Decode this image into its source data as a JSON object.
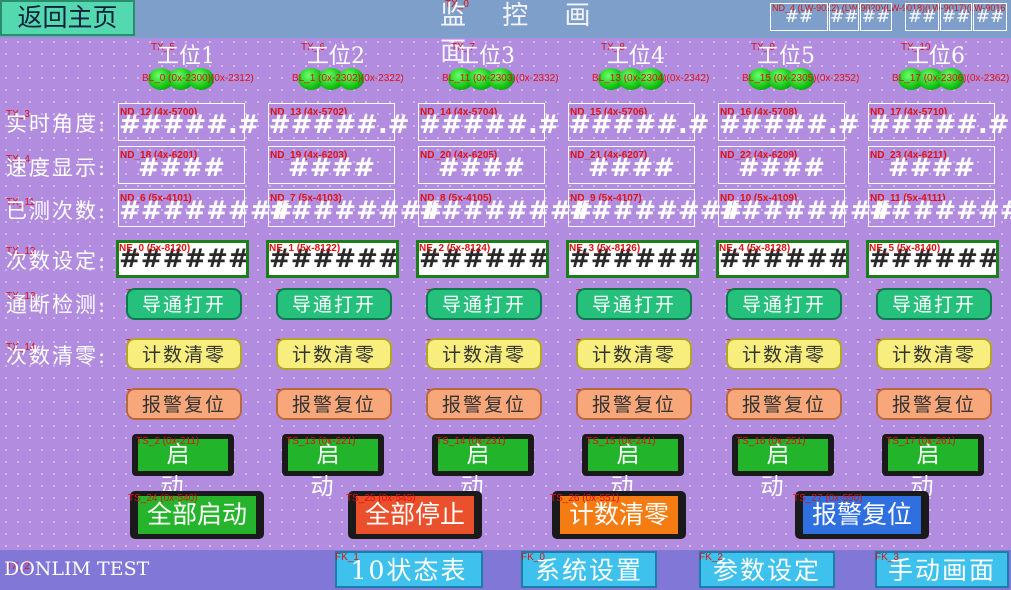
{
  "header": {
    "home_label": "返回主页",
    "title": "监 控 画 面",
    "title_tag": "TX_0",
    "top_tags": "ND_4 (LW-9022) (LW-9020)(LW-9018)(LW-9017)(LW-9016)",
    "top_nums": [
      "##",
      "##",
      "##",
      "##",
      "##",
      "##"
    ]
  },
  "stations": [
    {
      "head": "工位1",
      "tag": "TX_5",
      "bl": "BL_0 (0x-2300)(0x-2312)",
      "angle_tag": "ND_12 (4x-5700)",
      "speed_tag": "ND_18 (4x-6201)",
      "count_tag": "ND_6 (5x-4101)",
      "set_tag": "NE_0 (5x-8120)",
      "chk_tag": "TS_23 (0x-762)",
      "clr_tag": "TS_0 (0x-2101)",
      "rst_tag": "TS_1 (0x-2111)",
      "start_tag": "TS_2 (0x-211)"
    },
    {
      "head": "工位2",
      "tag": "TX_6",
      "bl": "BL_1 (0x-2302)(0x-2322)",
      "angle_tag": "ND_13 (4x-5702)",
      "speed_tag": "ND_19 (4x-6203)",
      "count_tag": "ND_7 (5x-4103)",
      "set_tag": "NE_1 (5x-8122)",
      "chk_tag": "TS_18 (0x-763)",
      "clr_tag": "TS_3 (0x-2102)",
      "rst_tag": "TS_9 (0x-2112)",
      "start_tag": "TS_13 (0x-221)"
    },
    {
      "head": "工位3",
      "tag": "TX_7",
      "bl": "BL_11 (0x-2303)(0x-2332)",
      "angle_tag": "ND_14 (4x-5704)",
      "speed_tag": "ND_20 (4x-6205)",
      "count_tag": "ND_8 (5x-4105)",
      "set_tag": "NE_2 (5x-8124)",
      "chk_tag": "TS_19 (0x-764)",
      "clr_tag": "TS_4 (0x-2103)",
      "rst_tag": "TS_8 (0x-2113)",
      "start_tag": "TS_14 (0x-231)"
    },
    {
      "head": "工位4",
      "tag": "TX_8",
      "bl": "BL_13 (0x-2304)(0x-2342)",
      "angle_tag": "ND_15 (4x-5706)",
      "speed_tag": "ND_21 (4x-6207)",
      "count_tag": "ND_9 (5x-4107)",
      "set_tag": "NE_3 (5x-8126)",
      "chk_tag": "TS_20 (0x-765)",
      "clr_tag": "TS_5 (0x-2104)",
      "rst_tag": "TS_12 (0x-2114)",
      "start_tag": "TS_15 (0x-241)"
    },
    {
      "head": "工位5",
      "tag": "TX_9",
      "bl": "BL_15 (0x-2305)(0x-2352)",
      "angle_tag": "ND_16 (4x-5708)",
      "speed_tag": "ND_22 (4x-6209)",
      "count_tag": "ND_10 (5x-4109)",
      "set_tag": "NE_4 (5x-8128)",
      "chk_tag": "TS_21 (0x-766)",
      "clr_tag": "TS_6 (0x-2105)",
      "rst_tag": "TS_11 (0x-2115)",
      "start_tag": "TS_16 (0x-251)"
    },
    {
      "head": "工位6",
      "tag": "TX_10",
      "bl": "BL_17 (0x-2306)(0x-2362)",
      "angle_tag": "ND_17 (4x-5710)",
      "speed_tag": "ND_23 (4x-6211)",
      "count_tag": "ND_11 (5x-4111)",
      "set_tag": "NE_5 (5x-8140)",
      "chk_tag": "TS_22 (0x-767)",
      "clr_tag": "TS_7 (0x-2106)",
      "rst_tag": "TS_10 (0x-2116)",
      "start_tag": "TS_17 (0x-261)"
    }
  ],
  "rows": {
    "angle": {
      "label": "实时角度:",
      "tag": "TX_3",
      "value": "#####.#"
    },
    "speed": {
      "label": "速度显示:",
      "tag": "TX_4",
      "value": "####"
    },
    "count": {
      "label": "已测次数:",
      "tag": "TX_11",
      "value": "########"
    },
    "set": {
      "label": "次数设定:",
      "tag": "TX_12",
      "value": "########"
    },
    "check": {
      "label": "通断检测:",
      "tag": "TX_13",
      "button": "导通打开"
    },
    "clear": {
      "label": "次数清零:",
      "tag": "TX_14",
      "button": "计数清零"
    },
    "reset": {
      "button": "报警复位"
    },
    "start": {
      "button": "启动"
    }
  },
  "big_buttons": [
    {
      "label": "全部启动",
      "tag": "TS_24 (0x-540)",
      "color": "#25b42b"
    },
    {
      "label": "全部停止",
      "tag": "TS_25 (0x-545)",
      "color": "#e9502b"
    },
    {
      "label": "计数清零",
      "tag": "TS_26 (0x-551)",
      "color": "#f47c12"
    },
    {
      "label": "报警复位",
      "tag": "TS_27 (0x-550)",
      "color": "#2f6fe0"
    }
  ],
  "footer": {
    "text": "DONLIM TEST",
    "tag": "TX_2",
    "keys": [
      {
        "label": "10状态表",
        "tag": "FK_1"
      },
      {
        "label": "系统设置",
        "tag": "FK_0"
      },
      {
        "label": "参数设定",
        "tag": "FK_2"
      },
      {
        "label": "手动画面",
        "tag": "FK_3"
      }
    ]
  },
  "colors": {
    "background": "#b28ddf",
    "topbar": "#7e9fc9",
    "lamp": "#0fbf0f",
    "fkey": "#3fc1ee",
    "home_btn": "#53d8b0"
  }
}
